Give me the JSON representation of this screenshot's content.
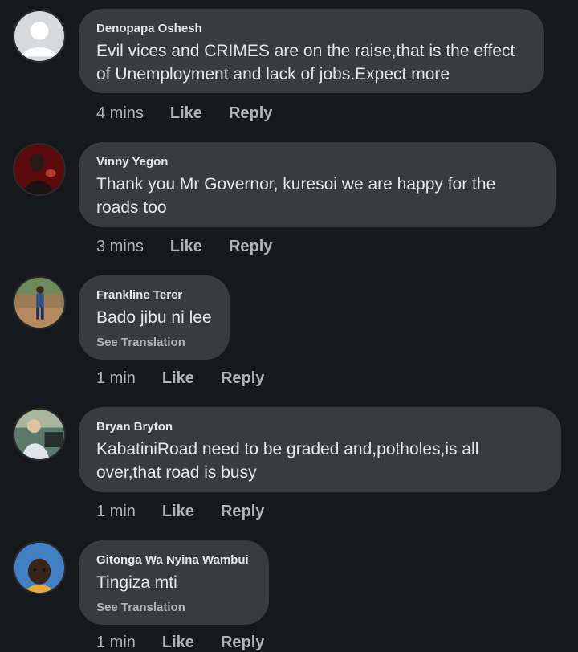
{
  "comments": [
    {
      "author": "Denopapa Oshesh",
      "text": "Evil vices and CRIMES are on the raise,that is the effect of Unemployment and lack of jobs.Expect more",
      "time": "4 mins",
      "like_label": "Like",
      "reply_label": "Reply"
    },
    {
      "author": "Vinny Yegon",
      "text": "Thank you Mr Governor, kuresoi we are happy for the roads too",
      "time": "3 mins",
      "like_label": "Like",
      "reply_label": "Reply"
    },
    {
      "author": "Frankline Terer",
      "text": "Bado jibu ni lee",
      "see_translation": "See Translation",
      "time": "1 min",
      "like_label": "Like",
      "reply_label": "Reply"
    },
    {
      "author": "Bryan Bryton",
      "text": "KabatiniRoad need to be graded and,potholes,is all over,that road is busy",
      "time": "1 min",
      "like_label": "Like",
      "reply_label": "Reply"
    },
    {
      "author": "Gitonga Wa Nyina Wambui",
      "text": "Tingiza mti",
      "see_translation": "See Translation",
      "time": "1 min",
      "like_label": "Like",
      "reply_label": "Reply"
    }
  ],
  "colors": {
    "background": "#18191a",
    "bubble": "#3a3b3c",
    "text": "#e4e6eb",
    "secondary": "#b0b3b8"
  }
}
